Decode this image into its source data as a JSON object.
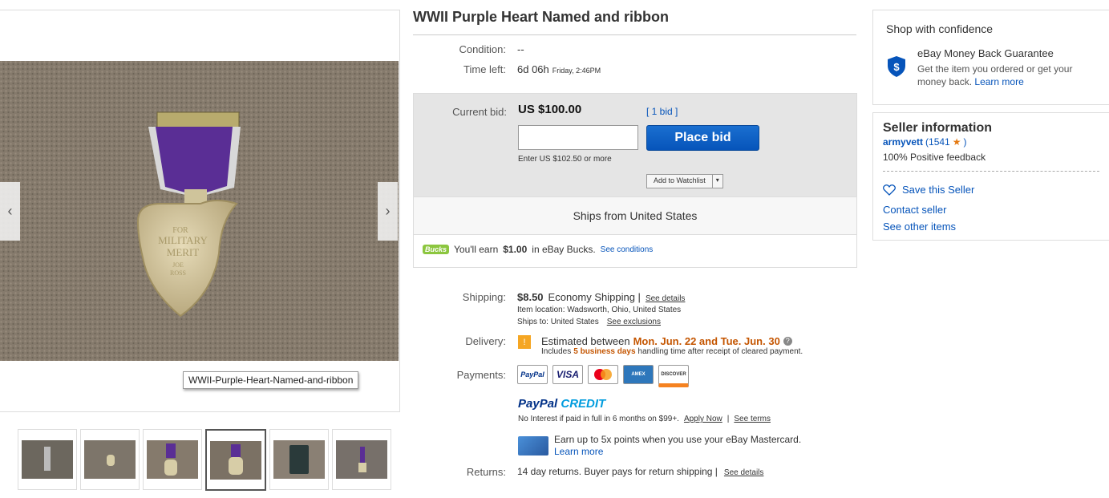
{
  "gallery": {
    "caption": "WWII-Purple-Heart-Named-and-ribbon",
    "prev_arrow": "‹",
    "next_arrow": "›",
    "medal_text": {
      "line1": "FOR",
      "line2": "MILITARY",
      "line3": "MERIT",
      "line4": "JOE",
      "line5": "ROSS"
    }
  },
  "listing": {
    "title": "WWII Purple Heart Named and ribbon",
    "condition_label": "Condition:",
    "condition_value": "--",
    "time_left_label": "Time left:",
    "time_left_value": "6d 06h",
    "time_left_end": "Friday, 2:46PM"
  },
  "bid": {
    "current_bid_label": "Current bid:",
    "current_bid_value": "US $100.00",
    "bids_count": "[ 1 bid ]",
    "input_value": "",
    "place_bid_label": "Place bid",
    "enter_hint": "Enter US $102.50 or more",
    "watchlist_label": "Add to Watchlist",
    "watchlist_dropdown": "▾",
    "ships_from": "Ships from United States",
    "bucks_logo": "Bucks",
    "bucks_prefix": "You'll earn",
    "bucks_amount": "$1.00",
    "bucks_suffix": "in eBay Bucks.",
    "bucks_link": "See conditions"
  },
  "shipping": {
    "label": "Shipping:",
    "cost": "$8.50",
    "method": "Economy Shipping |",
    "details_link": "See details",
    "location": "Item location:  Wadsworth, Ohio, United States",
    "ships_to_prefix": "Ships to:  United States",
    "exclusions_link": "See exclusions"
  },
  "delivery": {
    "label": "Delivery:",
    "icon": "!",
    "estimated_prefix": "Estimated between",
    "dates": "Mon. Jun. 22 and Tue. Jun. 30",
    "help_icon": "?",
    "includes_prefix": "Includes",
    "business_days": "5 business days",
    "includes_suffix": "handling time after receipt of cleared payment."
  },
  "payments": {
    "label": "Payments:",
    "methods": [
      "PayPal",
      "VISA",
      "MC",
      "AMEX",
      "DISCOVER"
    ],
    "paypal_credit_1": "PayPal",
    "paypal_credit_2": "CREDIT",
    "no_interest": "No Interest if paid in full in 6 months on $99+.",
    "apply_now": "Apply Now",
    "see_terms": "See terms",
    "mastercard_promo": "Earn up to 5x points when you use your eBay Mastercard.",
    "learn_more": "Learn more"
  },
  "returns": {
    "label": "Returns:",
    "value": "14 day returns. Buyer pays for return shipping |",
    "details_link": "See details"
  },
  "confidence": {
    "heading": "Shop with confidence",
    "guarantee_title": "eBay Money Back Guarantee",
    "guarantee_text": "Get the item you ordered or get your money back.",
    "learn_more": "Learn more"
  },
  "seller": {
    "heading": "Seller information",
    "name": "armyvett",
    "feedback_score": "(1541",
    "star": "★",
    "close_paren": ")",
    "positive": "100% Positive feedback",
    "save_seller": "Save this Seller",
    "contact": "Contact seller",
    "other_items": "See other items"
  },
  "colors": {
    "link": "#0654ba",
    "button": "#0654ba",
    "delivery_dates": "#c45500",
    "bucks_green": "#8cc63f"
  }
}
